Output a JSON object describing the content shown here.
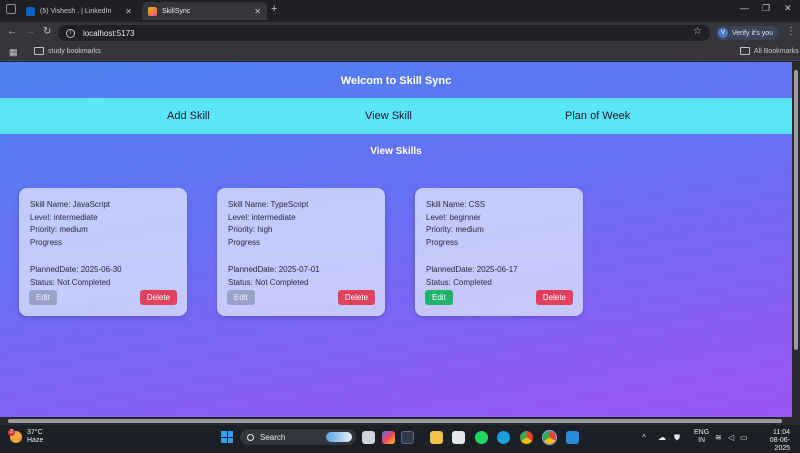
{
  "browser": {
    "tabs": [
      {
        "title": "(5) Vishesh . | LinkedIn",
        "favicon_color": "#0a66c2",
        "active": false
      },
      {
        "title": "SkillSync",
        "favicon_color": "#f4b400",
        "active": true
      }
    ],
    "new_tab_label": "+",
    "url": "localhost:5173",
    "profile_label": "Verify it's you",
    "profile_initial": "V",
    "bookmarks": {
      "left": "study bookmarks",
      "right": "All Bookmarks"
    }
  },
  "app": {
    "title": "Welcom to Skill Sync",
    "nav": [
      "Add Skill",
      "View Skill",
      "Plan of Week"
    ],
    "section_title": "View Skills",
    "edit_label": "Edit",
    "delete_label": "Delete",
    "progress_label": "Progress",
    "skills": [
      {
        "name": "Skill Name: JavaScript",
        "level": "Level: intermediate",
        "priority": "Priority: medium",
        "planned": "PlannedDate: 2025-06-30",
        "status": "Status: Not Completed",
        "completed": false,
        "progress": 0
      },
      {
        "name": "Skill Name: TypeScript",
        "level": "Level: intermediate",
        "priority": "Priority: high",
        "planned": "PlannedDate: 2025-07-01",
        "status": "Status: Not Completed",
        "completed": false,
        "progress": 0
      },
      {
        "name": "Skill Name: CSS",
        "level": "Level: beginner",
        "priority": "Priority: medium",
        "planned": "PlannedDate: 2025-06-17",
        "status": "Status: Completed",
        "completed": true,
        "progress": 0
      }
    ]
  },
  "colors": {
    "nav_bar": "#5be6f7",
    "delete": "#e2405f",
    "edit_enabled": "#1fb36b",
    "edit_disabled": "#9aa2c8"
  },
  "taskbar": {
    "weather_temp": "37°C",
    "weather_desc": "Haze",
    "weather_badge": "2",
    "search_placeholder": "Search",
    "lang1": "ENG",
    "lang2": "IN",
    "time": "11:04",
    "date": "08-06-2025"
  }
}
